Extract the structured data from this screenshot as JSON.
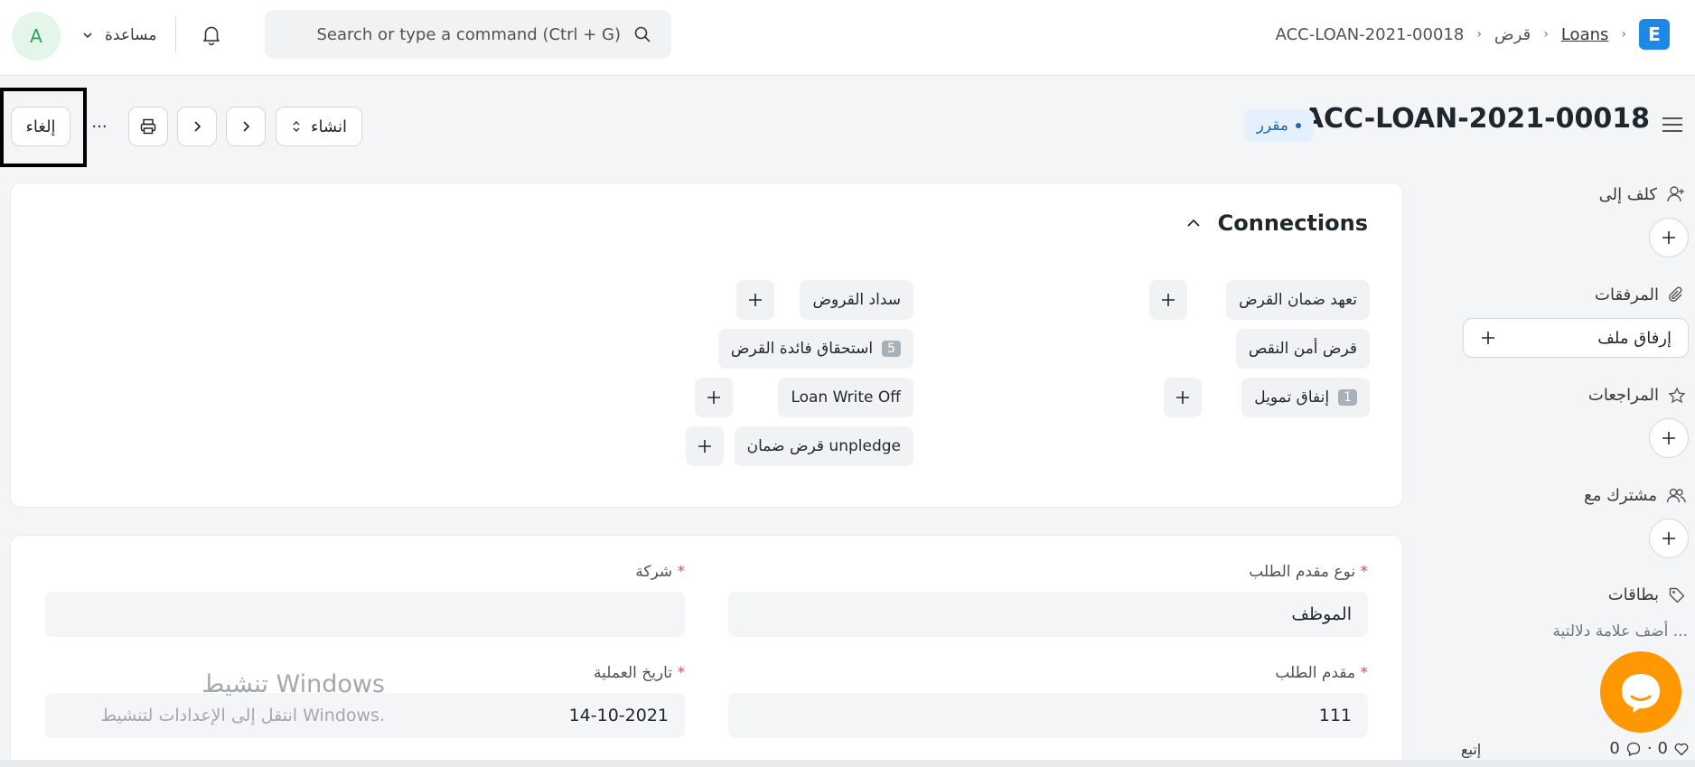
{
  "navbar": {
    "avatar_letter": "A",
    "help_label": "مساعدة",
    "search_placeholder": "Search or type a command (Ctrl + G)",
    "logo_letter": "E",
    "breadcrumb": [
      "Loans",
      "قرض",
      "ACC-LOAN-2021-00018"
    ]
  },
  "titlebar": {
    "title": "ACC-LOAN-2021-00018",
    "status": "مقرر",
    "create_label": "انشاء",
    "more_label": "···",
    "cancel_label": "إلغاء"
  },
  "connections": {
    "title": "Connections",
    "right_column": [
      {
        "label": "تعهد ضمان القرض",
        "count": null,
        "has_add": true
      },
      {
        "label": "قرض أمن النقص",
        "count": null,
        "has_add": false
      },
      {
        "label": "إنفاق تمويل",
        "count": "1",
        "has_add": true
      }
    ],
    "left_column": [
      {
        "label": "سداد القروض",
        "count": null,
        "has_add": true
      },
      {
        "label": "استحقاق فائدة القرض",
        "count": "5",
        "has_add": false
      },
      {
        "label": "Loan Write Off",
        "count": null,
        "has_add": true
      },
      {
        "label": "قرض ضمان unpledge",
        "count": null,
        "has_add": true
      }
    ]
  },
  "form": {
    "applicant_type_label": "نوع مقدم الطلب",
    "applicant_type_value": "الموظف",
    "company_label": "شركة",
    "company_value": "",
    "applicant_label": "مقدم الطلب",
    "applicant_value": "111",
    "posting_date_label": "تاريخ العملية",
    "posting_date_value": "14-10-2021",
    "required_mark": "*"
  },
  "sidebar": {
    "assign_label": "كلف إلى",
    "attachments_label": "المرفقات",
    "attach_file_label": "إرفاق ملف",
    "reviews_label": "المراجعات",
    "shared_label": "مشترك مع",
    "tags_label": "بطاقات",
    "tags_hint": "أضف علامة دلالتية ...",
    "likes_count": "0",
    "comments_count": "0",
    "stats_sep": "·",
    "follow_label": "إتبع"
  },
  "watermark": {
    "title": "تنشيط Windows",
    "subtitle": "انتقل إلى الإعدادات لتنشيط Windows."
  },
  "colors": {
    "accent": "#1e88e5",
    "status_bg": "#e4f1fc",
    "status_text": "#1b6aaf",
    "chat": "#ff9800",
    "required": "#e24c4c"
  }
}
